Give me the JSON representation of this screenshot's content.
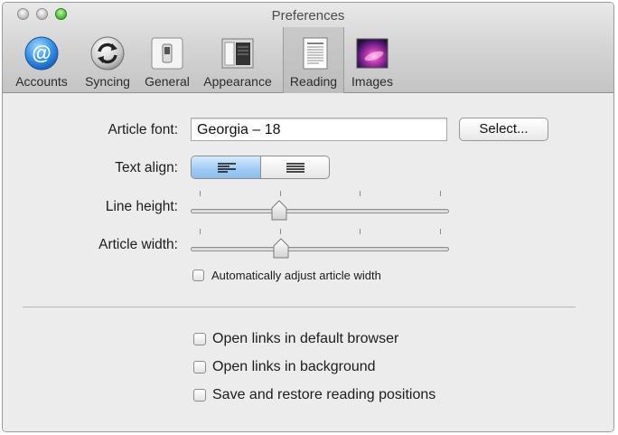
{
  "window": {
    "title": "Preferences"
  },
  "toolbar": {
    "items": [
      {
        "label": "Accounts",
        "icon": "at-sign-icon"
      },
      {
        "label": "Syncing",
        "icon": "sync-icon"
      },
      {
        "label": "General",
        "icon": "toggle-switch-icon"
      },
      {
        "label": "Appearance",
        "icon": "appearance-window-icon"
      },
      {
        "label": "Reading",
        "icon": "document-page-icon",
        "selected": true
      },
      {
        "label": "Images",
        "icon": "galaxy-image-icon"
      }
    ]
  },
  "reading": {
    "article_font": {
      "label": "Article font:",
      "value": "Georgia – 18",
      "select_label": "Select..."
    },
    "text_align": {
      "label": "Text align:",
      "options": [
        "align-left",
        "justify"
      ],
      "selected": "align-left"
    },
    "line_height": {
      "label": "Line height:",
      "value": 0.33,
      "ticks": 4
    },
    "article_width": {
      "label": "Article width:",
      "value": 0.34,
      "ticks": 4
    },
    "auto_adjust": {
      "label": "Automatically adjust article width",
      "checked": false
    }
  },
  "links": {
    "open_default": {
      "label": "Open links in default browser",
      "checked": false
    },
    "open_background": {
      "label": "Open links in background",
      "checked": false
    },
    "save_positions": {
      "label": "Save and restore reading positions",
      "checked": false
    }
  },
  "colors": {
    "accent": "#8bbcea",
    "toolbar_top": "#e9e9e9",
    "toolbar_bottom": "#c4c4c4",
    "panel": "#ececec"
  }
}
